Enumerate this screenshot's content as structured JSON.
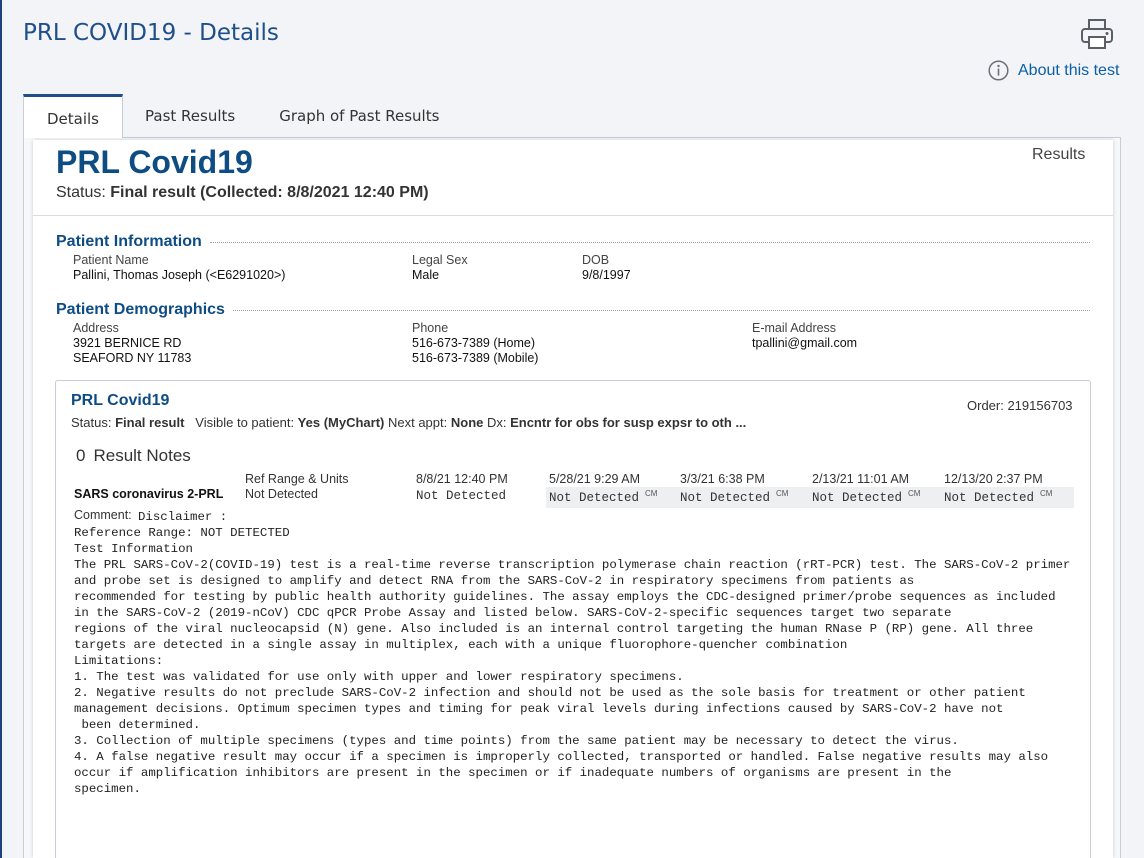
{
  "page": {
    "title": "PRL COVID19 - Details",
    "about_link": "About this test"
  },
  "tabs": [
    {
      "label": "Details",
      "active": true
    },
    {
      "label": "Past Results",
      "active": false
    },
    {
      "label": "Graph of Past Results",
      "active": false
    }
  ],
  "result": {
    "name": "PRL Covid19",
    "status_prefix": "Status: ",
    "status_value": "Final result",
    "collected": "(Collected: 8/8/2021 12:40 PM)",
    "results_label": "Results"
  },
  "patient_info": {
    "heading": "Patient Information",
    "name_label": "Patient Name",
    "name_value": "Pallini, Thomas Joseph (<E6291020>)",
    "sex_label": "Legal Sex",
    "sex_value": "Male",
    "dob_label": "DOB",
    "dob_value": "9/8/1997"
  },
  "demographics": {
    "heading": "Patient Demographics",
    "address_label": "Address",
    "address_line1": "3921 BERNICE RD",
    "address_line2": "SEAFORD NY 11783",
    "phone_label": "Phone",
    "phone_home": "516-673-7389 (Home)",
    "phone_mobile": "516-673-7389 (Mobile)",
    "email_label": "E-mail Address",
    "email_value": "tpallini@gmail.com"
  },
  "order": {
    "title": "PRL Covid19",
    "order_text": "Order: 219156703",
    "status_label": "Status: ",
    "status_value": "Final result",
    "visible_label": "Visible to patient: ",
    "visible_value": "Yes (MyChart)",
    "next_label": " Next appt: ",
    "next_value": "None",
    "dx_label": " Dx: ",
    "dx_value": "Encntr for obs for susp expsr to oth ...",
    "notes_count": "0",
    "notes_label": "Result Notes",
    "component_name": "SARS coronavirus 2-PRL",
    "ref_label": "Ref Range & Units",
    "ref_value": "Not Detected",
    "current": {
      "date": "8/8/21 12:40 PM",
      "value": "Not Detected"
    },
    "past": [
      {
        "date": "5/28/21  9:29 AM",
        "value": "Not Detected",
        "flag": "CM"
      },
      {
        "date": "3/3/21  6:38 PM",
        "value": "Not Detected",
        "flag": "CM"
      },
      {
        "date": "2/13/21 11:01 AM",
        "value": "Not Detected",
        "flag": "CM"
      },
      {
        "date": "12/13/20  2:37 PM",
        "value": "Not Detected",
        "flag": "CM"
      }
    ],
    "comment_label": "Comment:",
    "comment_lines": [
      "Disclaimer :",
      "Reference Range: NOT DETECTED",
      "Test Information",
      "The PRL SARS-CoV-2(COVID-19) test is a real-time reverse transcription polymerase chain reaction (rRT-PCR) test. The SARS-CoV-2 primer and probe set is designed to amplify and detect RNA from the SARS-CoV-2 in respiratory specimens from patients as",
      "recommended for testing by public health authority guidelines. The assay employs the CDC-designed primer/probe sequences as included in the SARS-CoV-2 (2019-nCoV) CDC qPCR Probe Assay and listed below. SARS-CoV-2-specific sequences target two separate",
      "regions of the viral nucleocapsid (N) gene. Also included is an internal control targeting the human RNase P (RP) gene. All three targets are detected in a single assay in multiplex, each with a unique fluorophore-quencher combination",
      "Limitations:",
      "1. The test was validated for use only with upper and lower respiratory specimens.",
      "2. Negative results do not preclude SARS-CoV-2 infection and should not be used as the sole basis for treatment or other patient management decisions. Optimum specimen types and timing for peak viral levels during infections caused by SARS-CoV-2 have not",
      " been determined.",
      "3. Collection of multiple specimens (types and time points) from the same patient may be necessary to detect the virus.",
      "4. A false negative result may occur if a specimen is improperly collected, transported or handled. False negative results may also occur if amplification inhibitors are present in the specimen or if inadequate numbers of organisms are present in the",
      "specimen."
    ]
  },
  "colors": {
    "accent": "#0e4c84",
    "link": "#0b5ea8",
    "tab_border": "#1f4f8a"
  }
}
